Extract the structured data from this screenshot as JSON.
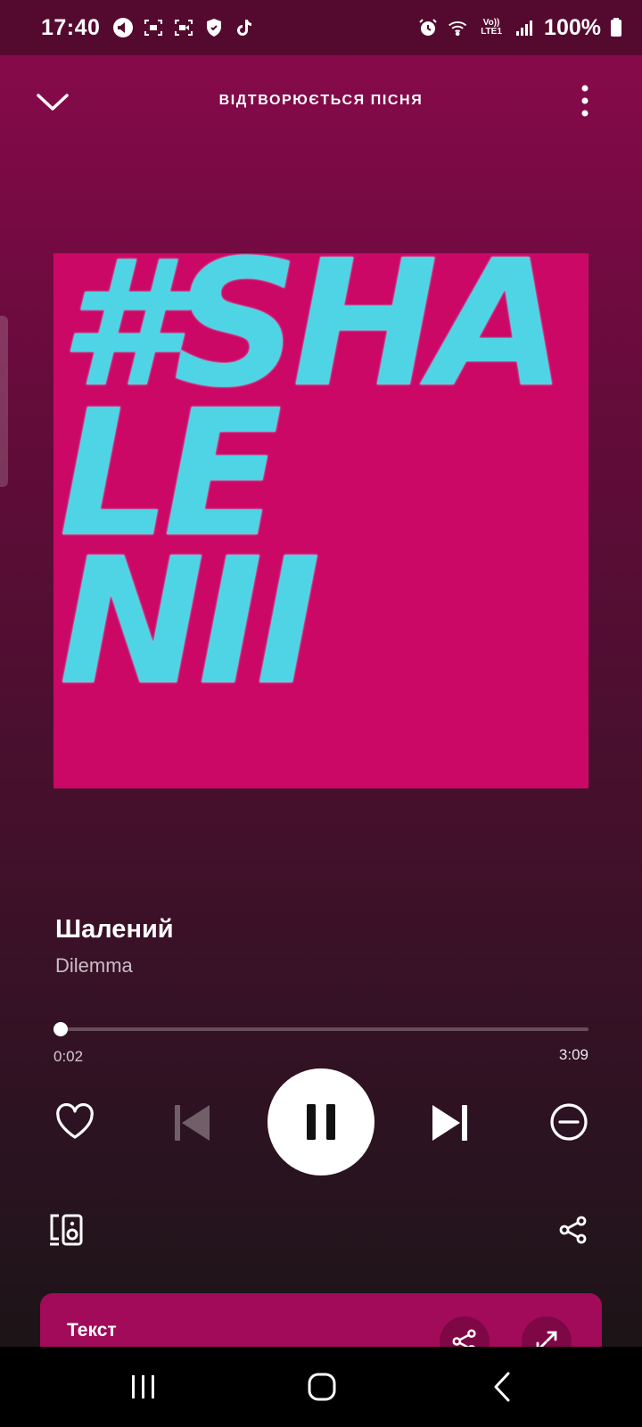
{
  "status_bar": {
    "time": "17:40",
    "battery": "100%",
    "network_label_top": "Vo))",
    "network_label_bottom": "LTE1",
    "left_icons": [
      "announcement-icon",
      "screen-capture-icon",
      "screen-record-icon",
      "shield-icon",
      "tiktok-icon"
    ],
    "right_icons": [
      "alarm-icon",
      "wifi-icon",
      "signal-icon",
      "battery-icon"
    ]
  },
  "header": {
    "title": "ВІДТВОРЮЄТЬСЯ ПІСНЯ"
  },
  "cover": {
    "lines": [
      "#SHA",
      "LE",
      "NII"
    ],
    "background": "#cc0867",
    "text_color": "#4fd4e6"
  },
  "track": {
    "title": "Шалений",
    "artist": "Dilemma"
  },
  "progress": {
    "elapsed": "0:02",
    "total": "3:09",
    "fraction": 0.0106
  },
  "controls": {
    "icons": [
      "heart-icon",
      "skip-previous-icon",
      "pause-icon",
      "skip-next-icon",
      "minus-circle-icon",
      "devices-icon",
      "share-icon"
    ]
  },
  "lyrics": {
    "title": "Текст"
  },
  "colors": {
    "accent": "#8c0a4e",
    "lyrics_card": "#a20b59"
  }
}
